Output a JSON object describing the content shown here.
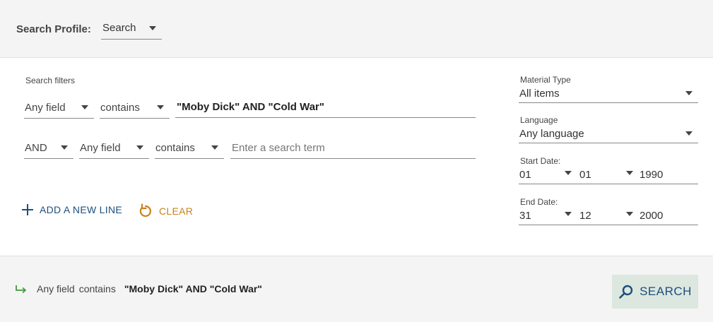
{
  "profile": {
    "label": "Search Profile:",
    "selected": "Search"
  },
  "filters": {
    "title": "Search filters",
    "rows": [
      {
        "field": "Any field",
        "op": "contains",
        "value": "\"Moby Dick\" AND \"Cold War\""
      },
      {
        "bool": "AND",
        "field": "Any field",
        "op": "contains",
        "placeholder": "Enter a search term"
      }
    ],
    "add_line_label": "ADD A NEW LINE",
    "clear_label": "CLEAR"
  },
  "side": {
    "material_type": {
      "label": "Material Type",
      "value": "All items"
    },
    "language": {
      "label": "Language",
      "value": "Any language"
    },
    "start_date": {
      "label": "Start Date:",
      "day": "01",
      "month": "01",
      "year": "1990"
    },
    "end_date": {
      "label": "End Date:",
      "day": "31",
      "month": "12",
      "year": "2000"
    }
  },
  "summary": {
    "field": "Any field",
    "op": "contains",
    "term": "\"Moby Dick\" AND \"Cold War\""
  },
  "search_button_label": "SEARCH",
  "colors": {
    "primary": "#1d4f7c",
    "clear": "#c8831a",
    "arrow": "#3f9a3f",
    "button_bg": "#dce7df",
    "bar_bg": "#f4f4f4"
  }
}
